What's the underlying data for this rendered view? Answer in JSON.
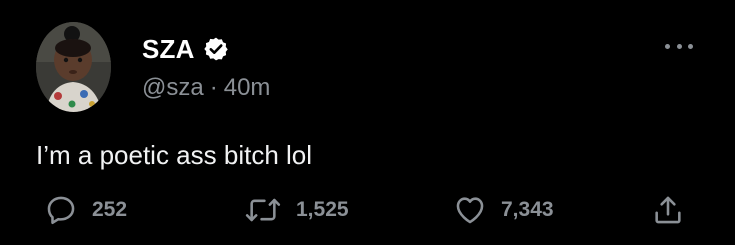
{
  "user": {
    "display_name": "SZA",
    "handle": "@sza",
    "separator": "·",
    "time": "40m",
    "verified": true
  },
  "tweet": {
    "text": "I’m a poetic ass bitch lol"
  },
  "actions": {
    "reply_count": "252",
    "retweet_count": "1,525",
    "like_count": "7,343"
  },
  "icons": {
    "avatar": "avatar-photo",
    "verified": "verified-badge-icon",
    "more": "more-options-icon",
    "reply": "reply-icon",
    "retweet": "retweet-icon",
    "like": "heart-icon",
    "share": "share-icon"
  },
  "colors": {
    "background": "#000000",
    "primary_text": "#e7e9ea",
    "secondary_text": "#8b9096"
  }
}
